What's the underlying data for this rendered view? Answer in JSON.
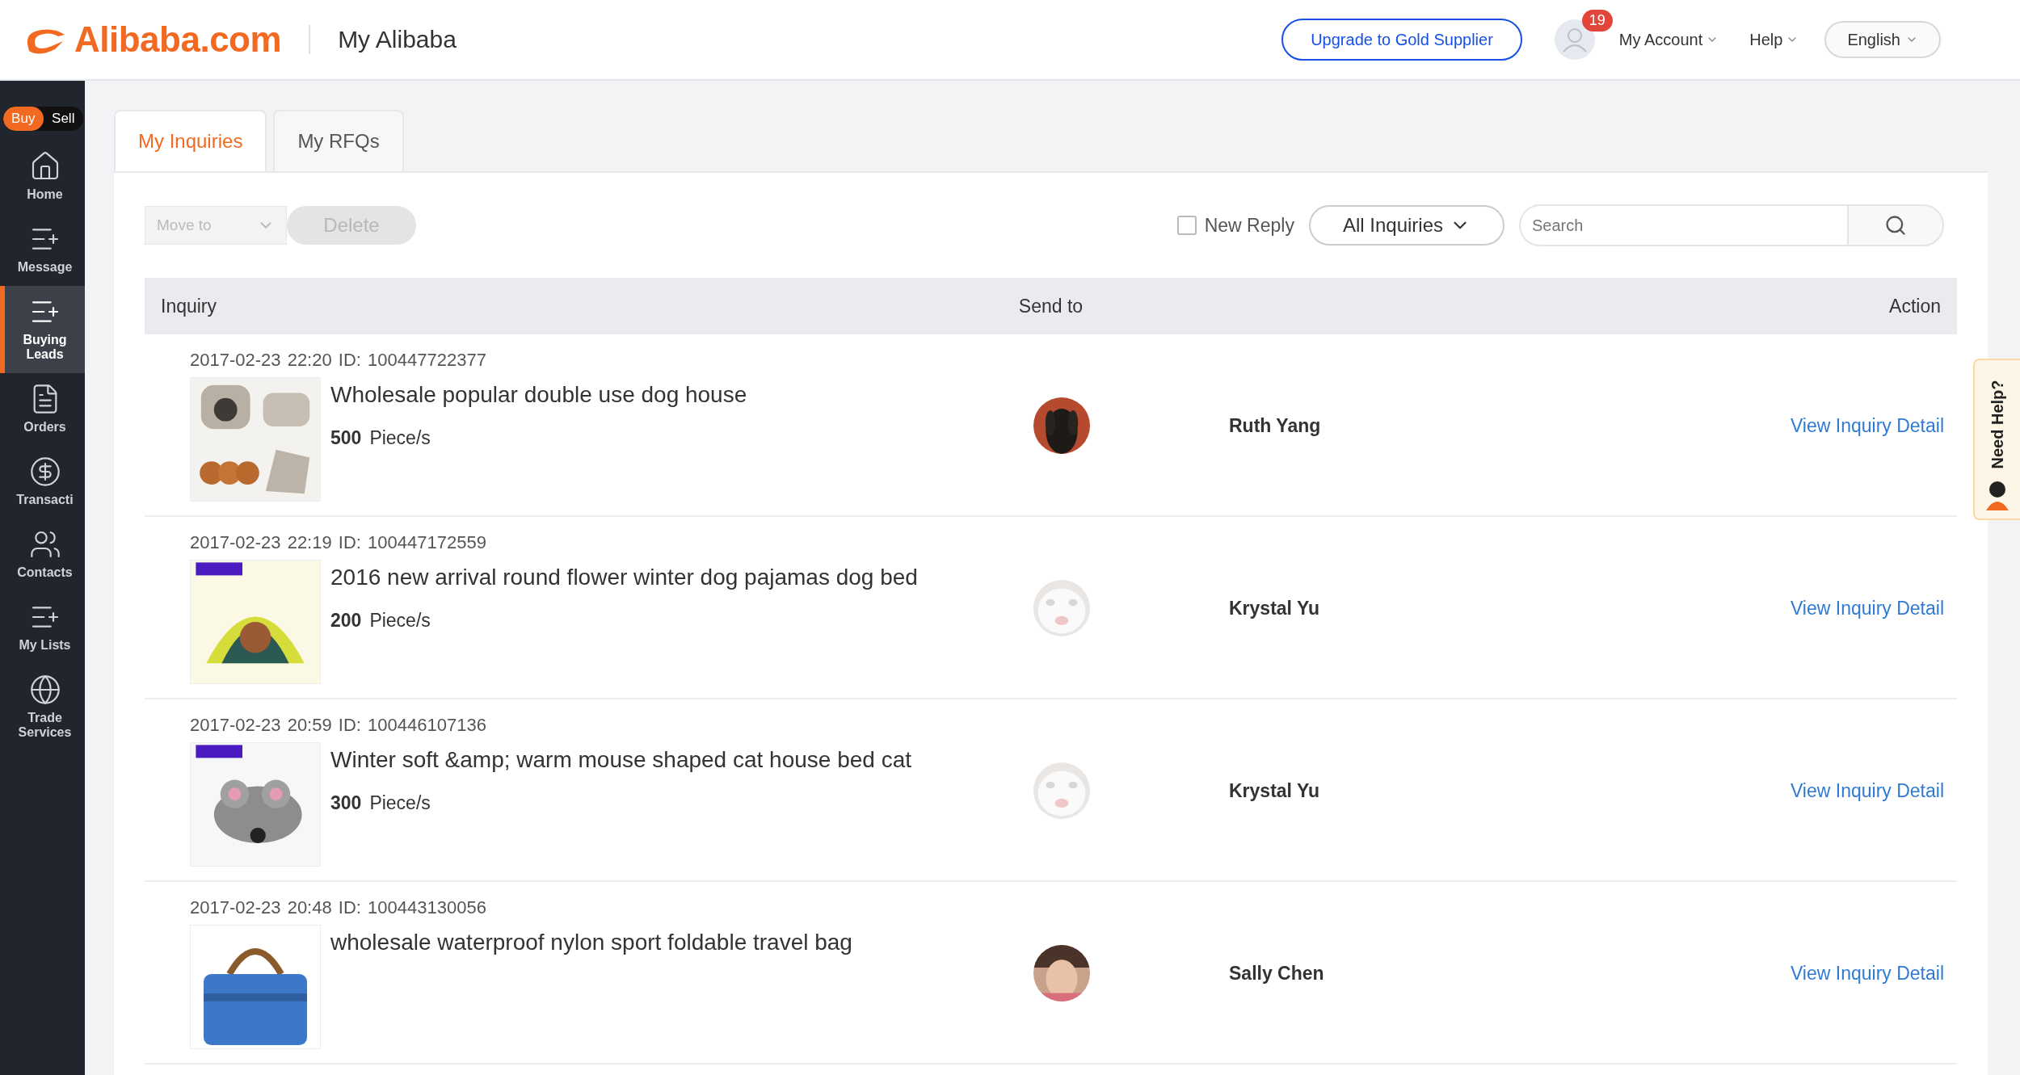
{
  "header": {
    "logo": "Alibaba.com",
    "title": "My Alibaba",
    "upgrade_button": "Upgrade to Gold Supplier",
    "notification_count": "19",
    "menus": [
      "My Account",
      "Help"
    ],
    "language": "English"
  },
  "sidebar": {
    "mode_toggle": [
      {
        "label": "Buy",
        "selected": true
      },
      {
        "label": "Sell",
        "selected": false
      }
    ],
    "items": [
      {
        "label": "Home",
        "kind": "home",
        "selected": false
      },
      {
        "label": "Message",
        "kind": "list",
        "selected": false
      },
      {
        "label": "Buying Leads",
        "kind": "list",
        "selected": true
      },
      {
        "label": "Orders",
        "kind": "document",
        "selected": false
      },
      {
        "label": "Transacti",
        "kind": "dollar",
        "selected": false
      },
      {
        "label": "Contacts",
        "kind": "people",
        "selected": false
      },
      {
        "label": "My Lists",
        "kind": "list",
        "selected": false
      },
      {
        "label": "Trade Services",
        "kind": "globe",
        "selected": false
      }
    ]
  },
  "tabs": [
    {
      "label": "My Inquiries",
      "selected": true
    },
    {
      "label": "My RFQs",
      "selected": false
    }
  ],
  "toolbar": {
    "move_to": {
      "placeholder": "Move to",
      "disabled": true
    },
    "delete_button": {
      "label": "Delete",
      "disabled": true
    },
    "new_reply": {
      "label": "New Reply",
      "checked": false
    },
    "filter": "All Inquiries",
    "search": {
      "placeholder": "Search"
    }
  },
  "table": {
    "columns": [
      "Inquiry",
      "Send to",
      "Action"
    ],
    "rows": [
      {
        "date": "2017-02-23 22:20",
        "id": "ID: 100447722377",
        "title": "Wholesale popular double use dog house",
        "quantity": "500",
        "unit": "Piece/s",
        "send_to": "Ruth Yang",
        "action": "View Inquiry Detail"
      },
      {
        "date": "2017-02-23 22:19",
        "id": "ID: 100447172559",
        "title": "2016 new arrival round flower winter dog pajamas dog bed",
        "quantity": "200",
        "unit": "Piece/s",
        "send_to": "Krystal Yu",
        "action": "View Inquiry Detail"
      },
      {
        "date": "2017-02-23 20:59",
        "id": "ID: 100446107136",
        "title": "Winter soft &amp; warm mouse shaped cat house bed cat",
        "quantity": "300",
        "unit": "Piece/s",
        "send_to": "Krystal Yu",
        "action": "View Inquiry Detail"
      },
      {
        "date": "2017-02-23 20:48",
        "id": "ID: 100443130056",
        "title": "wholesale waterproof nylon sport foldable travel bag",
        "send_to": "Sally Chen",
        "action": "View Inquiry Detail"
      }
    ]
  },
  "help_tab": "Need Help?"
}
